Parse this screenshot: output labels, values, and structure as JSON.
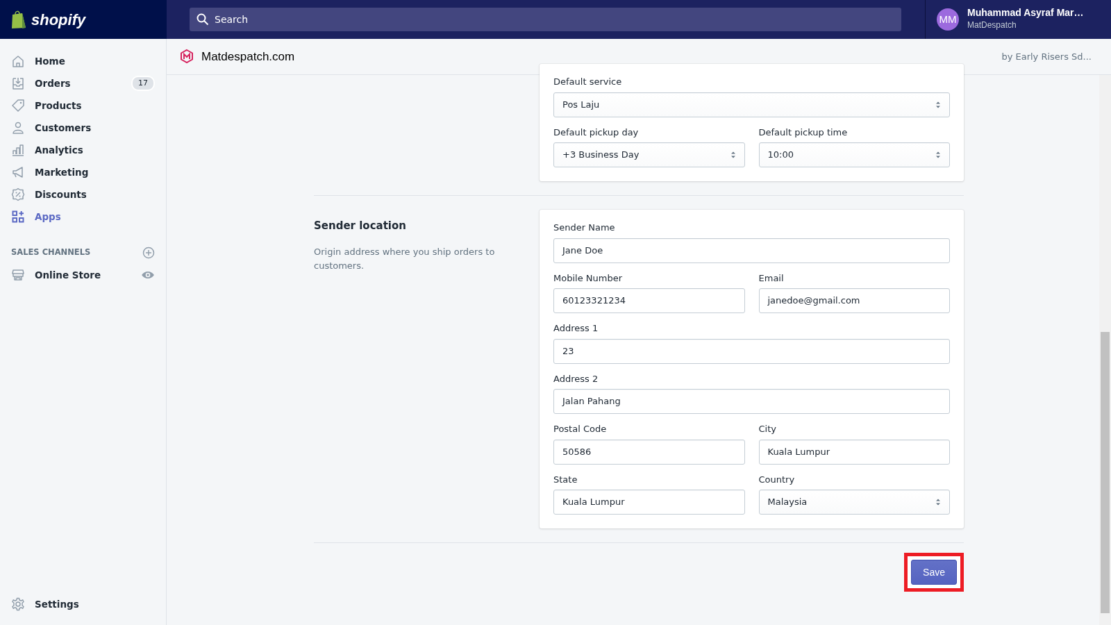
{
  "topbar": {
    "brand": "shopify",
    "search": {
      "placeholder": "Search"
    },
    "user": {
      "initials": "MM",
      "name": "Muhammad Asyraf Mar…",
      "store": "MatDespatch"
    }
  },
  "sidebar": {
    "items": [
      {
        "label": "Home",
        "selected": false
      },
      {
        "label": "Orders",
        "selected": false,
        "badge": "17"
      },
      {
        "label": "Products",
        "selected": false
      },
      {
        "label": "Customers",
        "selected": false
      },
      {
        "label": "Analytics",
        "selected": false
      },
      {
        "label": "Marketing",
        "selected": false
      },
      {
        "label": "Discounts",
        "selected": false
      },
      {
        "label": "Apps",
        "selected": true
      }
    ],
    "sales_channels": {
      "heading": "SALES CHANNELS",
      "items": [
        {
          "label": "Online Store",
          "selected": false
        }
      ]
    },
    "settings": {
      "label": "Settings",
      "selected": false
    }
  },
  "app_header": {
    "title": "Matdespatch.com",
    "developer": "by Early Risers Sd..."
  },
  "sections": [
    {
      "rows": [
        [
          {
            "label": "Default service",
            "kind": "select",
            "value": "Pos Laju"
          }
        ],
        [
          {
            "label": "Default pickup day",
            "kind": "select",
            "value": "+3 Business Day"
          },
          {
            "label": "Default pickup time",
            "kind": "select",
            "value": "10:00"
          }
        ]
      ]
    },
    {
      "title": "Sender location",
      "description": "Origin address where you ship orders to customers.",
      "rows": [
        [
          {
            "label": "Sender Name",
            "kind": "input",
            "value": "Jane Doe"
          }
        ],
        [
          {
            "label": "Mobile Number",
            "kind": "input",
            "value": "60123321234"
          },
          {
            "label": "Email",
            "kind": "input",
            "value": "janedoe@gmail.com"
          }
        ],
        [
          {
            "label": "Address 1",
            "kind": "input",
            "value": "23"
          }
        ],
        [
          {
            "label": "Address 2",
            "kind": "input",
            "value": "Jalan Pahang"
          }
        ],
        [
          {
            "label": "Postal Code",
            "kind": "input",
            "value": "50586"
          },
          {
            "label": "City",
            "kind": "input",
            "value": "Kuala Lumpur"
          }
        ],
        [
          {
            "label": "State",
            "kind": "input",
            "value": "Kuala Lumpur"
          },
          {
            "label": "Country",
            "kind": "select",
            "value": "Malaysia"
          }
        ]
      ]
    }
  ],
  "save_button": {
    "label": "Save",
    "highlighted": true
  }
}
